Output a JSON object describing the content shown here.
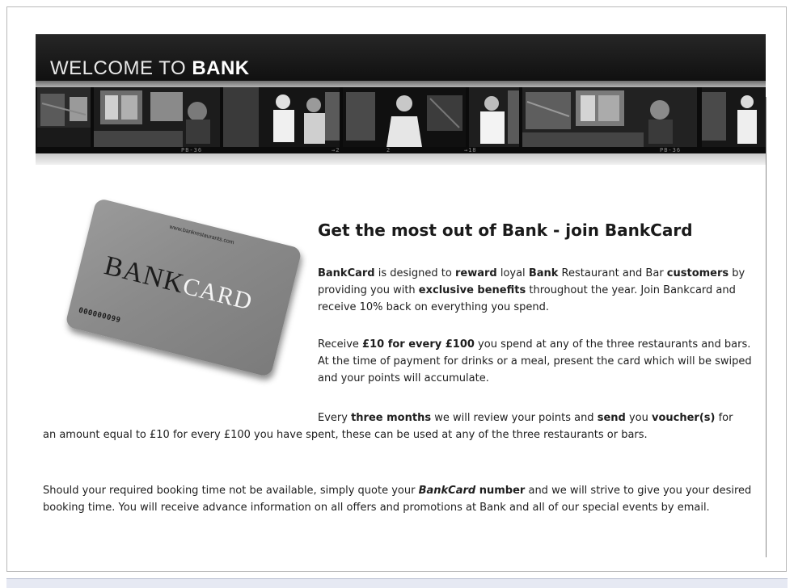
{
  "header": {
    "title_prefix": "WELCOME TO ",
    "title_bold": "BANK"
  },
  "film_strip": {
    "frame_numbers": [
      "PB-36",
      "→2",
      "2",
      "→18",
      "PB-36"
    ]
  },
  "card": {
    "url": "www.bankrestaurants.com",
    "brand_left": "BANK",
    "brand_right": "CARD",
    "number": "000000099"
  },
  "content": {
    "heading": "Get the most out of Bank - join BankCard",
    "p1": {
      "s1": "BankCard",
      "s2": " is designed to ",
      "s3": "reward",
      "s4": " loyal ",
      "s5": "Bank",
      "s6": " Restaurant and Bar ",
      "s7": "customers",
      "s8": " by providing you with ",
      "s9": "exclusive benefits",
      "s10": " throughout the year. Join Bankcard and receive 10% back on everything you spend."
    },
    "p2": {
      "s1": "Receive ",
      "s2": "£10 for every £100",
      "s3": " you spend at any of the three restaurants and bars. At the time of payment for drinks or a meal, present the card which will be swiped and your points will accumulate."
    },
    "p3": {
      "s1": "Every ",
      "s2": "three months",
      "s3": " we will review your points and ",
      "s4": "send",
      "s5": " you ",
      "s6": "voucher(s)",
      "s7": " for",
      "line2": "an amount equal to £10 for every £100 you have spent, these can be used at any of the three restaurants or bars."
    },
    "p4": {
      "s1": "Should your required booking time not be available, simply quote your ",
      "s2": "BankCard",
      "s3": " number",
      "s4": " and we will strive to give you your desired booking time. You will receive advance information on all offers and promotions at Bank and all of our special events by email."
    }
  }
}
